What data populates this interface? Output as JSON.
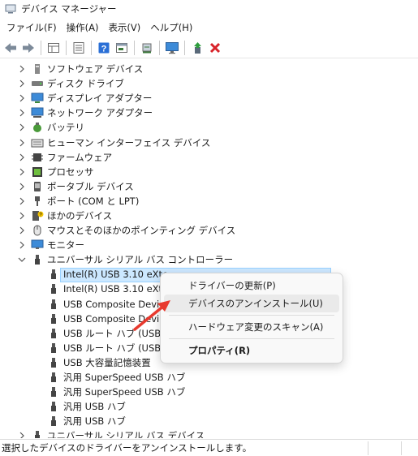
{
  "window": {
    "title": "デバイス マネージャー"
  },
  "menu": [
    "ファイル(F)",
    "操作(A)",
    "表示(V)",
    "ヘルプ(H)"
  ],
  "toolbar": [
    "back-arrow-icon",
    "forward-arrow-icon",
    "properties-grid-icon",
    "list-view-icon",
    "help-icon",
    "console-icon",
    "scan-hardware-icon",
    "monitor-icon",
    "update-driver-icon",
    "uninstall-x-icon"
  ],
  "tree": {
    "categories": [
      "ソフトウェア デバイス",
      "ディスク ドライブ",
      "ディスプレイ アダプター",
      "ネットワーク アダプター",
      "バッテリ",
      "ヒューマン インターフェイス デバイス",
      "ファームウェア",
      "プロセッサ",
      "ポータブル デバイス",
      "ポート (COM と LPT)",
      "ほかのデバイス",
      "マウスとそのほかのポインティング デバイス",
      "モニター",
      "ユニバーサル シリアル バス コントローラー"
    ],
    "usb_children": [
      "Intel(R) USB 3.10 eXte",
      "Intel(R) USB 3.10 eXte",
      "USB Composite Devic",
      "USB Composite Devi",
      "USB ルート ハブ (USB 3.",
      "USB ルート ハブ (USB 3.",
      "USB 大容量記憶装置",
      "汎用 SuperSpeed USB ハブ",
      "汎用 SuperSpeed USB ハブ",
      "汎用 USB ハブ",
      "汎用 USB ハブ"
    ],
    "partial_last": "ユニバーサル シリアル バス デバイス"
  },
  "context_menu": {
    "update_driver": "ドライバーの更新(P)",
    "uninstall": "デバイスのアンインストール(U)",
    "scan": "ハードウェア変更のスキャン(A)",
    "properties": "プロパティ(R)"
  },
  "status": {
    "text": "選択したデバイスのドライバーをアンインストールします。"
  },
  "colors": {
    "selection": "#cce8ff",
    "arrow": "#e8392e",
    "delete": "#d8232a",
    "help_blue": "#2a6fd6"
  }
}
